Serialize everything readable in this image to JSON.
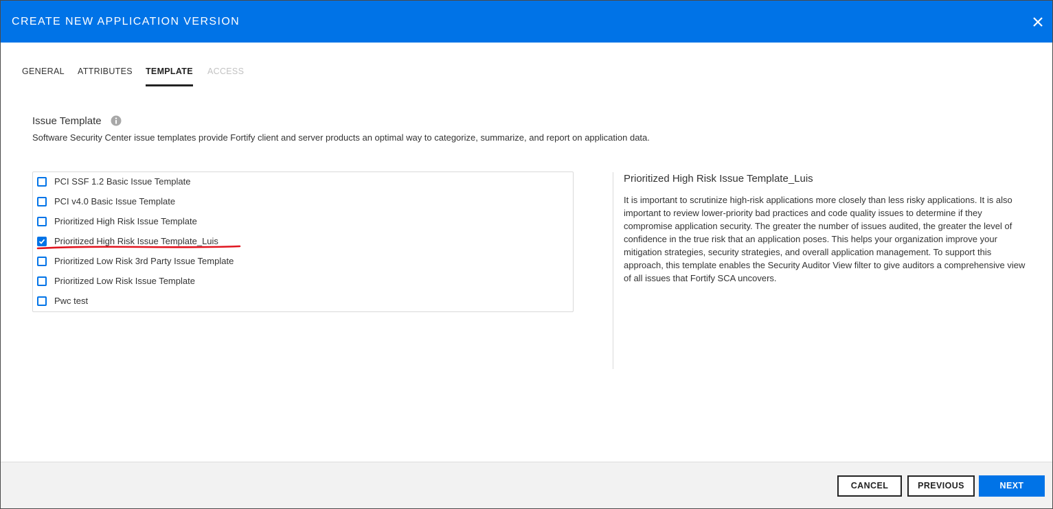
{
  "dialog": {
    "title": "CREATE NEW APPLICATION VERSION",
    "close_icon": "close-icon"
  },
  "tabs": [
    {
      "label": "GENERAL",
      "state": "normal"
    },
    {
      "label": "ATTRIBUTES",
      "state": "normal"
    },
    {
      "label": "TEMPLATE",
      "state": "active"
    },
    {
      "label": "ACCESS",
      "state": "disabled"
    }
  ],
  "section": {
    "title": "Issue Template",
    "info_icon": "info-icon",
    "description": "Software Security Center issue templates provide Fortify client and server products an optimal way to categorize, summarize, and report on application data."
  },
  "templates": [
    {
      "label": "PCI SSF 1.2 Basic Issue Template",
      "checked": false
    },
    {
      "label": "PCI v4.0 Basic Issue Template",
      "checked": false
    },
    {
      "label": "Prioritized High Risk Issue Template",
      "checked": false
    },
    {
      "label": "Prioritized High Risk Issue Template_Luis",
      "checked": true
    },
    {
      "label": "Prioritized Low Risk 3rd Party Issue Template",
      "checked": false
    },
    {
      "label": "Prioritized Low Risk Issue Template",
      "checked": false
    },
    {
      "label": "Pwc test",
      "checked": false
    }
  ],
  "detail": {
    "title": "Prioritized High Risk Issue Template_Luis",
    "description": "It is important to scrutinize high-risk applications more closely than less risky applications. It is also important to review lower-priority bad practices and code quality issues to determine if they compromise application security. The greater the number of issues audited, the greater the level of confidence in the true risk that an application poses. This helps your organization improve your mitigation strategies, security strategies, and overall application management. To support this approach, this template enables the Security Auditor View filter to give auditors a comprehensive view of all issues that Fortify SCA uncovers."
  },
  "footer": {
    "cancel_label": "CANCEL",
    "previous_label": "PREVIOUS",
    "next_label": "NEXT"
  },
  "colors": {
    "accent": "#0073e7",
    "annotation": "#e0141e",
    "footer_bg": "#f2f2f2"
  }
}
